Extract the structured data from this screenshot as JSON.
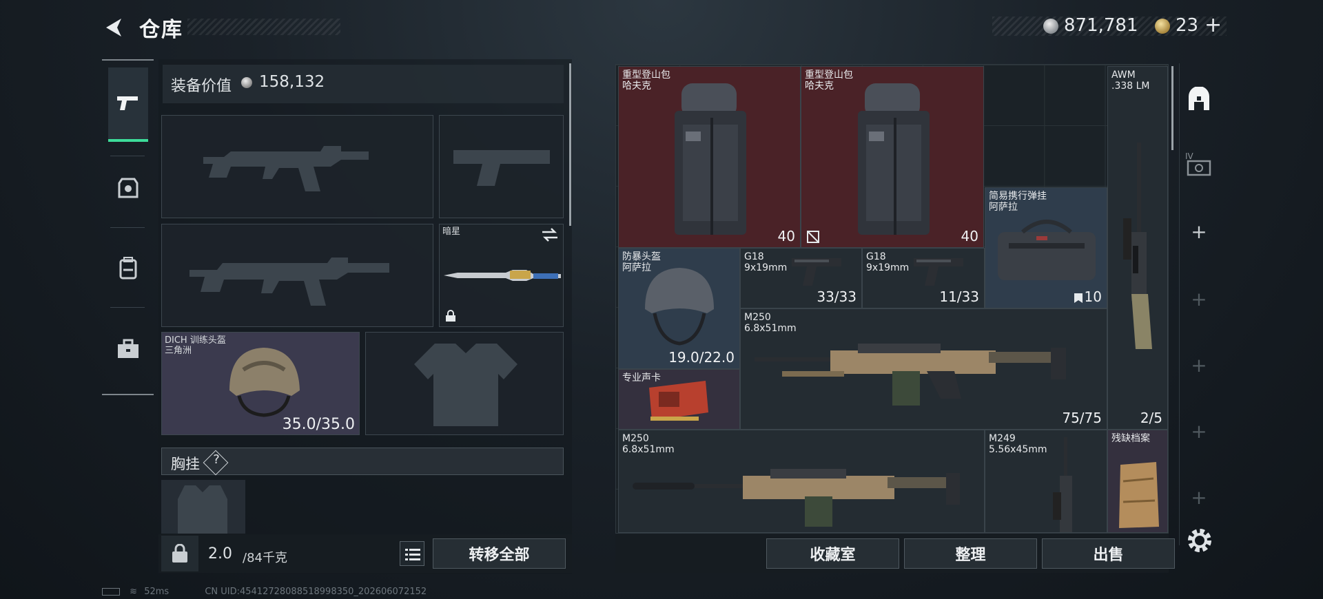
{
  "header": {
    "title": "仓库",
    "currency_silver": "871,781",
    "currency_gold": "23",
    "add_label": "+"
  },
  "equipment": {
    "value_label": "装备价值",
    "value": "158,132",
    "melee_name": "暗星",
    "helmet": {
      "name": "DICH 训练头盔",
      "sub": "三角洲",
      "durability": "35.0/35.0"
    },
    "chest_label": "胸挂",
    "chest_help": "?",
    "weight": "2.0",
    "weight_max": "/84千克",
    "transfer_all": "转移全部"
  },
  "storage": {
    "items": [
      {
        "name": "重型登山包",
        "sub": "哈夫克",
        "count": "40"
      },
      {
        "name": "重型登山包",
        "sub": "哈夫克",
        "count": "40"
      },
      {
        "name": "AWM",
        "sub": ".338 LM",
        "count": "2/5"
      },
      {
        "name": "简易携行弹挂",
        "sub": "阿萨拉",
        "count": "10"
      },
      {
        "name": "防暴头盔",
        "sub": "阿萨拉",
        "count": "19.0/22.0"
      },
      {
        "name": "G18",
        "sub": "9x19mm",
        "count": "33/33"
      },
      {
        "name": "G18",
        "sub": "9x19mm",
        "count": "11/33"
      },
      {
        "name": "M250",
        "sub": "6.8x51mm",
        "count": "75/75"
      },
      {
        "name": "专业声卡",
        "sub": "",
        "count": ""
      },
      {
        "name": "M250",
        "sub": "6.8x51mm",
        "count": ""
      },
      {
        "name": "M249",
        "sub": "5.56x45mm",
        "count": ""
      },
      {
        "name": "残缺档案",
        "sub": "",
        "count": ""
      }
    ],
    "buttons": {
      "collection": "收藏室",
      "sort": "整理",
      "sell": "出售"
    }
  },
  "rightbar": {
    "plus": "+",
    "tag_iv": "IV"
  },
  "status": {
    "ping": "52ms",
    "uid": "CN UID:45412728088518998350_202606072152"
  },
  "colors": {
    "accent": "#3ddc9a",
    "backpack_bg": "#4a2227",
    "blue_bg": "#2f3d4c"
  }
}
